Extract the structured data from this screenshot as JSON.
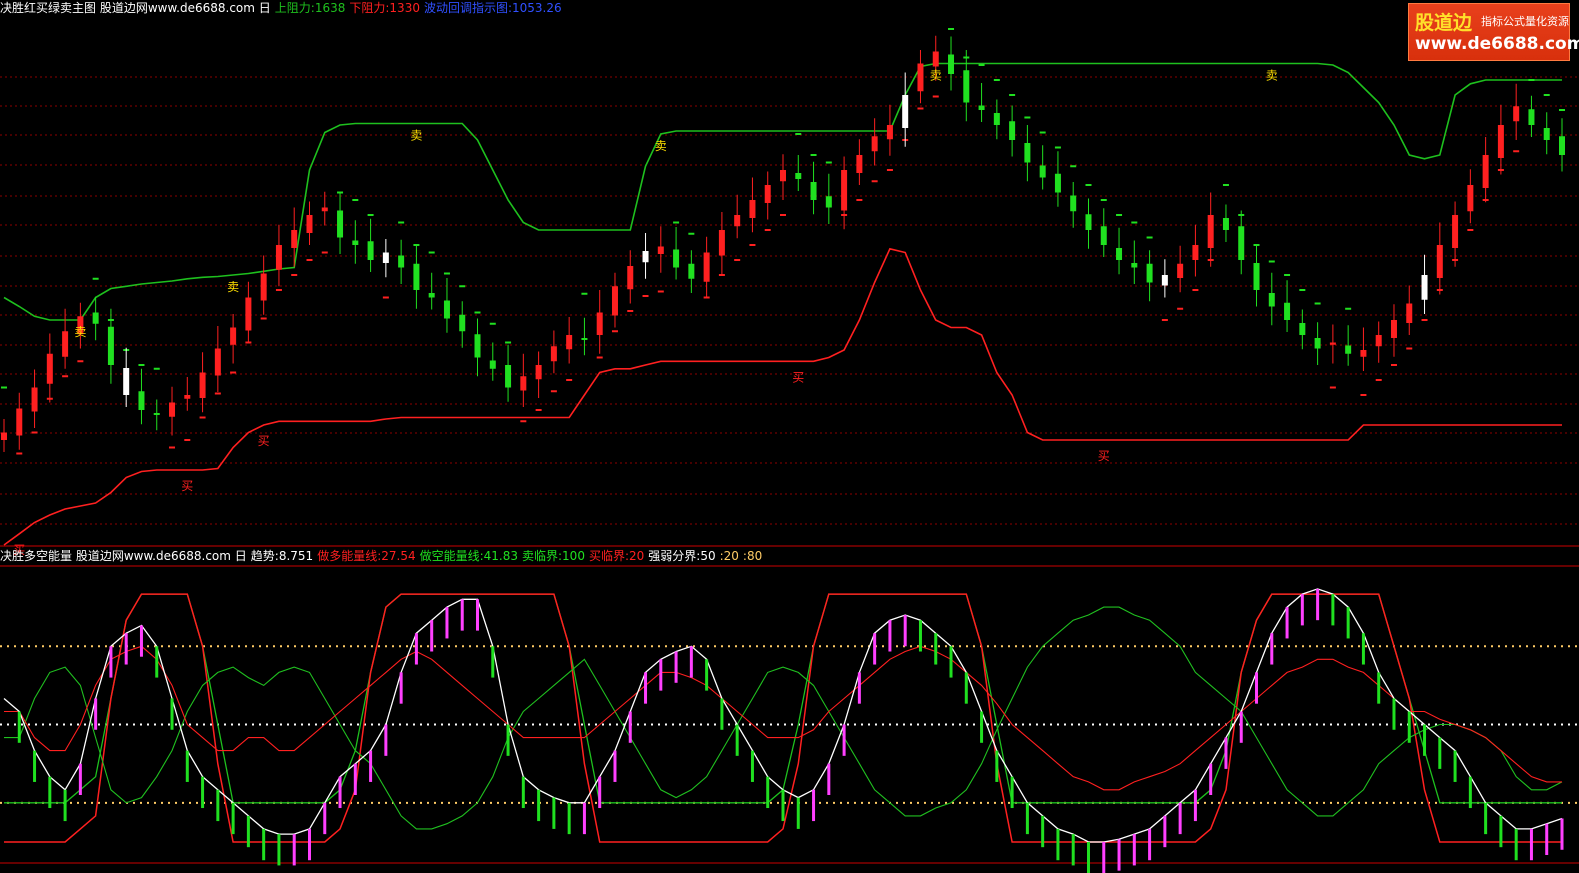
{
  "top_header": {
    "title": "决胜红买绿卖主图 股道边网www.de6688.com 日",
    "upper_label": "上阻力:1638",
    "lower_label": "下阻力:1330",
    "band_label": "波动回调指示图:1053.26"
  },
  "bottom_header": {
    "title": "决胜多空能量 股道边网www.de6688.com 日",
    "trend_label": "趋势:8.751",
    "long_label": "做多能量线:27.54",
    "short_label": "做空能量线:41.83",
    "sell_label": "卖临界:100",
    "buy_label": "买临界:20",
    "split_label": "强弱分界:50",
    "extra1": ":20",
    "extra2": ":80"
  },
  "logo": {
    "brand": "股道边",
    "tagline": "指标公式量化资源",
    "url": "www.de6688.com"
  },
  "colors": {
    "up": "#ff2020",
    "down": "#20e020",
    "neutral": "#ffffff",
    "resistance_upper": "#1ec01e",
    "resistance_lower": "#ff2020",
    "sell_marker": "#ffe000",
    "buy_marker": "#ff2020",
    "trend": "#ffffff",
    "trend_bar": "#ff40ff",
    "long_line": "#ff2020",
    "short_line": "#20c020",
    "gridline": "#8b0000",
    "divider": "#cc0000"
  },
  "chart_data": [
    {
      "type": "candlestick",
      "title": "决胜红买绿卖主图",
      "ylim": [
        1000,
        1700
      ],
      "upper_resistance": 1638,
      "lower_resistance": 1330,
      "marker_labels": {
        "sell": "卖",
        "buy": "买"
      },
      "sell_markers_at_index": [
        5,
        15,
        27,
        43,
        61,
        83,
        116
      ],
      "buy_markers_at_index": [
        1,
        12,
        17,
        52,
        72,
        107
      ],
      "upper_path": [
        1330,
        1318,
        1305,
        1300,
        1300,
        1300,
        1330,
        1342,
        1345,
        1348,
        1350,
        1352,
        1355,
        1357,
        1358,
        1360,
        1362,
        1365,
        1368,
        1370,
        1500,
        1550,
        1560,
        1562,
        1562,
        1562,
        1562,
        1562,
        1562,
        1562,
        1562,
        1540,
        1500,
        1460,
        1430,
        1420,
        1420,
        1420,
        1420,
        1420,
        1420,
        1420,
        1505,
        1548,
        1552,
        1552,
        1552,
        1552,
        1552,
        1552,
        1552,
        1552,
        1552,
        1552,
        1552,
        1552,
        1552,
        1552,
        1552,
        1600,
        1638,
        1642,
        1642,
        1642,
        1642,
        1642,
        1642,
        1642,
        1642,
        1642,
        1642,
        1642,
        1642,
        1642,
        1642,
        1642,
        1642,
        1642,
        1642,
        1642,
        1642,
        1642,
        1642,
        1642,
        1642,
        1642,
        1642,
        1640,
        1630,
        1610,
        1590,
        1560,
        1520,
        1515,
        1520,
        1600,
        1615,
        1620,
        1620,
        1620,
        1620,
        1620,
        1620
      ],
      "lower_path": [
        1000,
        1015,
        1030,
        1040,
        1048,
        1052,
        1056,
        1070,
        1090,
        1098,
        1100,
        1100,
        1100,
        1100,
        1102,
        1130,
        1150,
        1160,
        1165,
        1165,
        1165,
        1165,
        1165,
        1165,
        1165,
        1168,
        1170,
        1170,
        1170,
        1170,
        1170,
        1170,
        1170,
        1170,
        1170,
        1170,
        1170,
        1170,
        1200,
        1230,
        1235,
        1235,
        1240,
        1245,
        1245,
        1245,
        1245,
        1245,
        1245,
        1245,
        1245,
        1245,
        1245,
        1245,
        1250,
        1260,
        1300,
        1350,
        1395,
        1390,
        1340,
        1300,
        1290,
        1290,
        1280,
        1230,
        1200,
        1150,
        1140,
        1140,
        1140,
        1140,
        1140,
        1140,
        1140,
        1140,
        1140,
        1140,
        1140,
        1140,
        1140,
        1140,
        1140,
        1140,
        1140,
        1140,
        1140,
        1140,
        1140,
        1160,
        1160,
        1160,
        1160,
        1160,
        1160,
        1160,
        1160,
        1160,
        1160,
        1160,
        1160,
        1160,
        1160
      ],
      "close": [
        1150,
        1182,
        1210,
        1255,
        1285,
        1305,
        1295,
        1240,
        1200,
        1180,
        1175,
        1190,
        1200,
        1230,
        1262,
        1290,
        1330,
        1362,
        1400,
        1420,
        1440,
        1450,
        1410,
        1400,
        1380,
        1390,
        1370,
        1340,
        1330,
        1302,
        1285,
        1250,
        1235,
        1210,
        1225,
        1240,
        1265,
        1280,
        1275,
        1310,
        1345,
        1372,
        1392,
        1398,
        1370,
        1355,
        1390,
        1420,
        1440,
        1460,
        1480,
        1500,
        1488,
        1460,
        1450,
        1500,
        1520,
        1545,
        1560,
        1600,
        1642,
        1658,
        1628,
        1590,
        1580,
        1560,
        1540,
        1510,
        1490,
        1470,
        1445,
        1420,
        1400,
        1380,
        1370,
        1350,
        1360,
        1375,
        1400,
        1440,
        1420,
        1380,
        1340,
        1318,
        1300,
        1280,
        1262,
        1270,
        1255,
        1260,
        1280,
        1300,
        1322,
        1360,
        1400,
        1440,
        1480,
        1520,
        1560,
        1585,
        1560,
        1540,
        1520
      ]
    },
    {
      "type": "line",
      "title": "决胜多空能量",
      "ylim": [
        0,
        110
      ],
      "reference_lines": [
        20,
        50,
        80
      ],
      "sell_critical": 100,
      "buy_critical": 20,
      "trend_value": 8.751,
      "long_energy_value": 27.54,
      "short_energy_value": 41.83,
      "trend": [
        60,
        55,
        40,
        30,
        25,
        35,
        60,
        80,
        85,
        88,
        80,
        60,
        40,
        30,
        25,
        20,
        15,
        10,
        8,
        8,
        10,
        20,
        30,
        35,
        40,
        50,
        70,
        85,
        90,
        95,
        98,
        98,
        80,
        50,
        30,
        25,
        22,
        20,
        20,
        30,
        40,
        55,
        70,
        75,
        78,
        80,
        75,
        60,
        50,
        40,
        30,
        25,
        22,
        25,
        35,
        50,
        70,
        85,
        90,
        92,
        90,
        85,
        80,
        70,
        55,
        40,
        30,
        20,
        15,
        10,
        8,
        5,
        5,
        6,
        8,
        10,
        15,
        20,
        25,
        35,
        45,
        55,
        70,
        85,
        95,
        100,
        102,
        100,
        95,
        85,
        70,
        60,
        55,
        50,
        45,
        40,
        30,
        20,
        15,
        10,
        10,
        12,
        14
      ],
      "long_energy": [
        55,
        55,
        45,
        40,
        40,
        50,
        65,
        75,
        78,
        80,
        75,
        65,
        50,
        45,
        40,
        40,
        45,
        45,
        40,
        40,
        45,
        50,
        55,
        60,
        65,
        70,
        75,
        78,
        75,
        70,
        65,
        60,
        55,
        50,
        45,
        45,
        45,
        45,
        45,
        50,
        55,
        60,
        65,
        70,
        70,
        68,
        65,
        60,
        55,
        50,
        45,
        45,
        45,
        48,
        55,
        60,
        65,
        70,
        75,
        78,
        80,
        78,
        75,
        70,
        65,
        58,
        50,
        45,
        40,
        35,
        30,
        28,
        25,
        25,
        28,
        30,
        32,
        35,
        40,
        45,
        50,
        55,
        60,
        65,
        70,
        72,
        75,
        75,
        72,
        70,
        65,
        60,
        55,
        55,
        52,
        50,
        48,
        45,
        40,
        35,
        30,
        28,
        28
      ],
      "short_energy": [
        45,
        45,
        60,
        70,
        72,
        65,
        45,
        25,
        20,
        22,
        30,
        40,
        55,
        65,
        70,
        72,
        68,
        65,
        70,
        72,
        70,
        60,
        50,
        40,
        35,
        25,
        15,
        10,
        10,
        12,
        15,
        20,
        30,
        45,
        55,
        60,
        65,
        70,
        75,
        65,
        55,
        45,
        35,
        25,
        22,
        25,
        30,
        40,
        50,
        60,
        70,
        72,
        70,
        65,
        55,
        45,
        35,
        25,
        20,
        15,
        15,
        18,
        20,
        25,
        35,
        48,
        60,
        72,
        80,
        85,
        90,
        92,
        95,
        95,
        92,
        90,
        85,
        80,
        70,
        65,
        60,
        55,
        45,
        35,
        25,
        20,
        15,
        15,
        20,
        25,
        35,
        40,
        45,
        48,
        50,
        50,
        48,
        45,
        40,
        30,
        25,
        25,
        28
      ],
      "strength_band": [
        20,
        20,
        20,
        20,
        20,
        25,
        30,
        60,
        90,
        100,
        100,
        100,
        100,
        80,
        50,
        20,
        20,
        20,
        20,
        20,
        20,
        20,
        25,
        40,
        70,
        95,
        100,
        100,
        100,
        100,
        100,
        100,
        100,
        100,
        100,
        100,
        100,
        80,
        50,
        20,
        20,
        20,
        20,
        20,
        20,
        20,
        20,
        20,
        20,
        20,
        20,
        25,
        50,
        80,
        100,
        100,
        100,
        100,
        100,
        100,
        100,
        100,
        100,
        100,
        80,
        50,
        20,
        20,
        20,
        20,
        20,
        20,
        20,
        20,
        20,
        20,
        20,
        20,
        20,
        25,
        40,
        70,
        90,
        100,
        100,
        100,
        100,
        100,
        100,
        100,
        100,
        80,
        60,
        40,
        20,
        20,
        20,
        20,
        20,
        20,
        20,
        20,
        20
      ]
    }
  ]
}
